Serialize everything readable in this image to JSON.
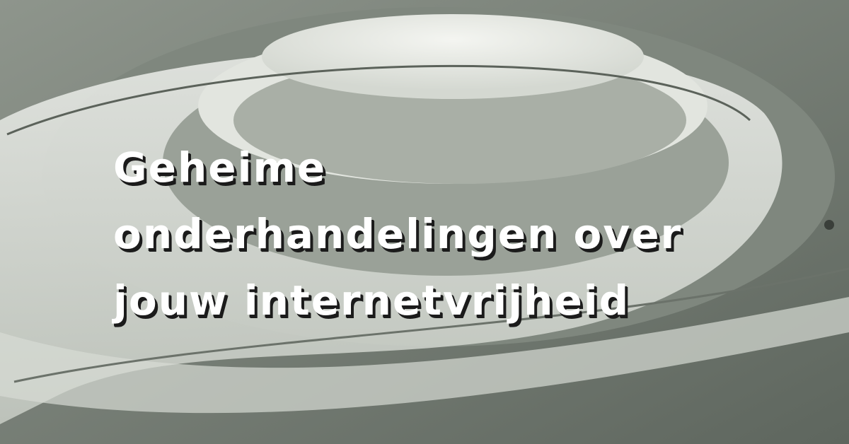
{
  "banner": {
    "headline_lines": [
      "Geheime",
      "onderhandelingen over",
      "jouw internetvrijheid"
    ]
  }
}
